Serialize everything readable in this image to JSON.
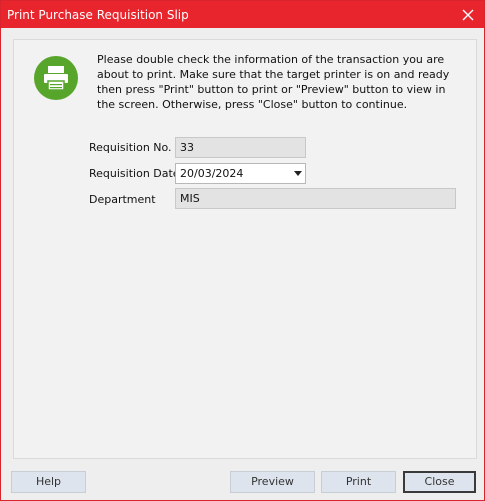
{
  "window": {
    "title": "Print Purchase Requisition Slip"
  },
  "icons": {
    "close": "close-icon",
    "printer": "printer-icon",
    "dropdown": "chevron-down-icon"
  },
  "message": "Please double check the information of the transaction you are about to print. Make sure that the target printer is on and ready then press \"Print\" button to print or \"Preview\" button to view in the screen. Otherwise, press \"Close\" button to continue.",
  "form": {
    "requisition_no": {
      "label": "Requisition No.",
      "value": "33"
    },
    "requisition_date": {
      "label": "Requisition Date",
      "value": "20/03/2024"
    },
    "department": {
      "label": "Department",
      "value": "MIS"
    }
  },
  "buttons": {
    "help": "Help",
    "preview": "Preview",
    "print": "Print",
    "close": "Close"
  },
  "colors": {
    "titlebar": "#e8242d",
    "icon_bg": "#58a52c",
    "button_bg": "#dde4ee"
  }
}
